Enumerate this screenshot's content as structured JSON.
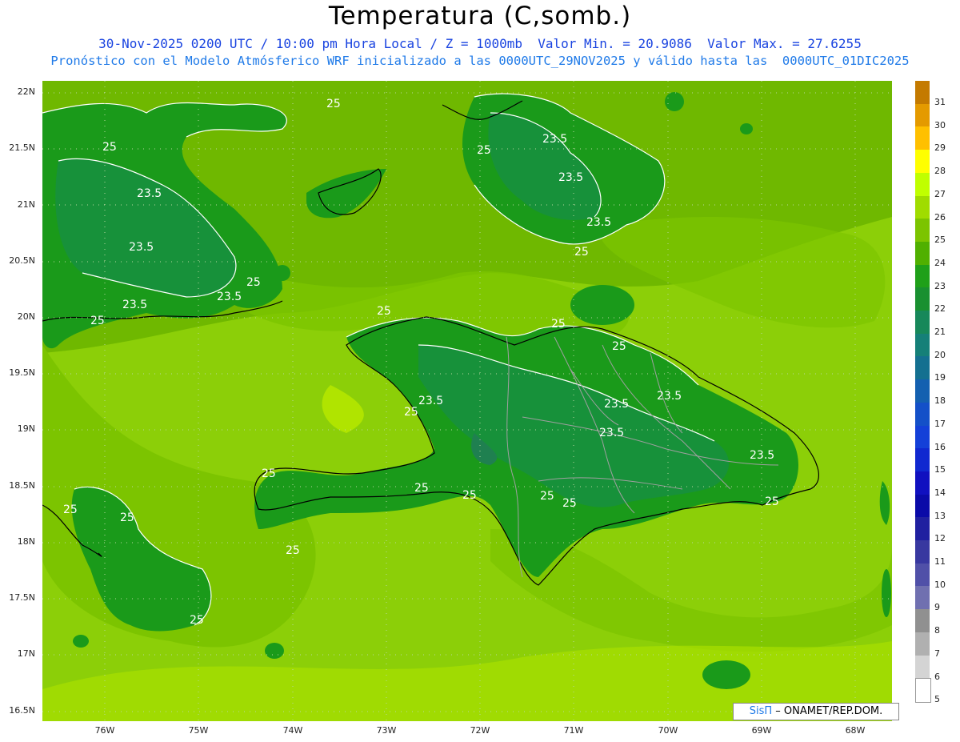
{
  "header": {
    "title": "Temperatura (C,somb.)",
    "subtitle1": "30-Nov-2025 0200 UTC / 10:00 pm Hora Local / Z = 1000mb  Valor Min. = 20.9086  Valor Max. = 27.6255",
    "subtitle2": "Pronóstico con el Modelo Atmósferico WRF inicializado a las 0000UTC_29NOV2025 y válido hasta las  0000UTC_01DIC2025"
  },
  "axes": {
    "lat_labels": [
      "22N",
      "21.5N",
      "21N",
      "20.5N",
      "20N",
      "19.5N",
      "19N",
      "18.5N",
      "18N",
      "17.5N",
      "17N",
      "16.5N"
    ],
    "lon_labels": [
      "76W",
      "75W",
      "74W",
      "73W",
      "72W",
      "71W",
      "70W",
      "69W",
      "68W"
    ]
  },
  "contour_labels": [
    "25",
    "25",
    "23.5",
    "23.5",
    "23.5",
    "23.5",
    "25",
    "25",
    "23.5",
    "25",
    "23.5",
    "25",
    "23.5",
    "25",
    "25",
    "23.5",
    "23.5",
    "23.5",
    "23.5",
    "25",
    "25",
    "25",
    "25",
    "25",
    "25",
    "25",
    "25",
    "23.5",
    "25",
    "25",
    "25",
    "25"
  ],
  "colorbar": {
    "labels": [
      "31",
      "30",
      "29",
      "28",
      "27",
      "26",
      "25",
      "24",
      "23",
      "22",
      "21",
      "20",
      "19",
      "18",
      "17",
      "16",
      "15",
      "14",
      "13",
      "12",
      "11",
      "10",
      "9",
      "8",
      "7",
      "6",
      "5"
    ],
    "colors": [
      "#c47a00",
      "#e49a00",
      "#ffc000",
      "#ffff00",
      "#c0ff00",
      "#a0dc00",
      "#7cc400",
      "#50b000",
      "#1fa019",
      "#199030",
      "#17885a",
      "#158078",
      "#147090",
      "#1460b0",
      "#1450c8",
      "#1440d8",
      "#1028d0",
      "#1010c0",
      "#0a0aa8",
      "#2020a0",
      "#3838a0",
      "#5050a8",
      "#7070b0",
      "#909090",
      "#b0b0b0",
      "#d4d4d4",
      "#ffffff"
    ]
  },
  "credit": {
    "sis": "SisΠ",
    "text": " – ONAMET/REP.DOM."
  }
}
